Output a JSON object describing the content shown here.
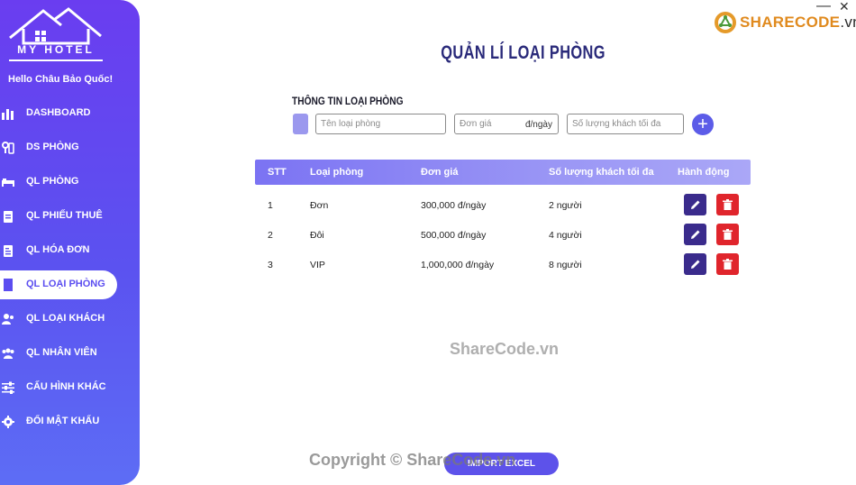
{
  "window": {
    "minimize": "—",
    "close": "✕"
  },
  "brand": {
    "name": "SHARECODE",
    "suffix": ".vn"
  },
  "sidebar": {
    "logo_text": "MY HOTEL",
    "greeting": "Hello Châu Bảo Quốc!",
    "items": [
      {
        "label": "DASHBOARD",
        "icon": "bar-chart-icon"
      },
      {
        "label": "DS PHÒNG",
        "icon": "room-key-icon"
      },
      {
        "label": "QL PHÒNG",
        "icon": "bed-icon"
      },
      {
        "label": "QL PHIẾU THUÊ",
        "icon": "clipboard-icon"
      },
      {
        "label": "QL HÓA ĐƠN",
        "icon": "invoice-icon"
      },
      {
        "label": "QL LOẠI PHÒNG",
        "icon": "door-icon",
        "active": true
      },
      {
        "label": "QL LOẠI KHÁCH",
        "icon": "user-group-icon"
      },
      {
        "label": "QL NHÂN VIÊN",
        "icon": "users-icon"
      },
      {
        "label": "CẤU HÌNH KHÁC",
        "icon": "sliders-icon"
      },
      {
        "label": "ĐỔI MẬT KHẨU",
        "icon": "gear-icon"
      }
    ]
  },
  "main": {
    "title": "QUẢN LÍ LOẠI PHÒNG",
    "form": {
      "section_title": "THÔNG TIN LOẠI PHÒNG",
      "name_placeholder": "Tên loại phòng",
      "price_placeholder": "Đơn giá",
      "price_unit": "đ/ngày",
      "max_placeholder": "Số lượng khách tối đa",
      "add_label": "+"
    },
    "table": {
      "headers": [
        "STT",
        "Loại phòng",
        "Đơn giá",
        "Số lượng khách tối đa",
        "Hành động"
      ],
      "rows": [
        {
          "stt": "1",
          "type": "Đơn",
          "price": "300,000 đ/ngày",
          "max": "2 người"
        },
        {
          "stt": "2",
          "type": "Đôi",
          "price": "500,000 đ/ngày",
          "max": "4 người"
        },
        {
          "stt": "3",
          "type": "VIP",
          "price": "1,000,000 đ/ngày",
          "max": "8 người"
        }
      ]
    },
    "import_label": "IMPORT EXCEL",
    "watermark_center": "ShareCode.vn",
    "watermark_bottom": "Copyright © ShareCode.vn"
  },
  "colors": {
    "sidebar_top": "#6a3df0",
    "sidebar_bottom": "#5d6df5",
    "accent": "#5c5ce8",
    "edit": "#3a2b8c",
    "delete": "#e0252c",
    "title": "#2a2a7a"
  }
}
